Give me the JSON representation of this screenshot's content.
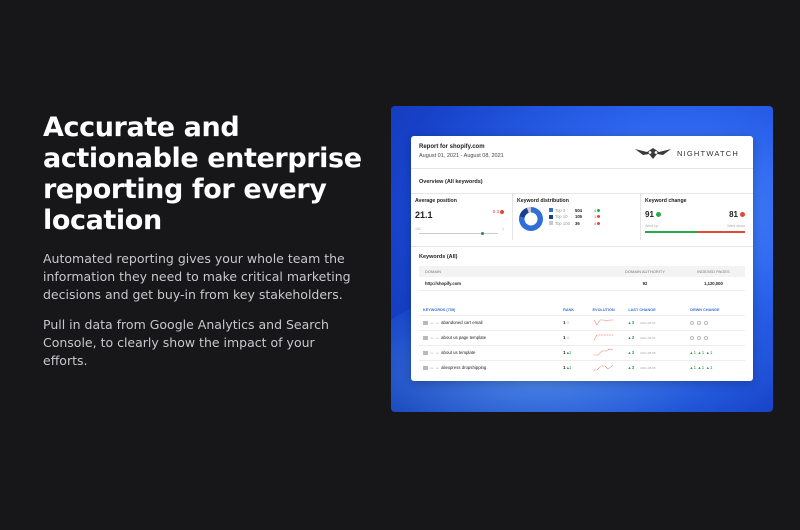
{
  "hero": {
    "title": "Accurate and actionable enterprise reporting for every location",
    "paragraph1": "Automated reporting gives your whole team the information they need to make critical marketing decisions and get buy-in from key stakeholders.",
    "paragraph2": "Pull in data from Google Analytics and Search Console, to clearly show the impact of your efforts."
  },
  "report": {
    "title": "Report for shopify.com",
    "dates": "August 01, 2021 - August 08, 2021",
    "brand": "NIGHTWATCH",
    "overview_heading": "Overview (All keywords)",
    "average_position": {
      "label": "Average position",
      "value": "21.1",
      "change": "0.3",
      "scale_min": "101",
      "scale_max": "1",
      "level": 0.78
    },
    "keyword_distribution": {
      "label": "Keyword distribution",
      "items": [
        {
          "name": "Top 3",
          "value": "504",
          "change": "4",
          "trend": "up",
          "color": "#2f6fd6"
        },
        {
          "name": "Top 10",
          "value": "105",
          "change": "1",
          "trend": "down",
          "color": "#163f8c"
        },
        {
          "name": "Top 100",
          "value": "36",
          "change": "4",
          "trend": "down",
          "color": "#c9c9d6"
        }
      ]
    },
    "keyword_change": {
      "label": "Keyword change",
      "up_value": "91",
      "down_value": "81",
      "up_label": "Went up",
      "down_label": "Went down",
      "up_color": "#2aa84a",
      "down_color": "#e0483a"
    },
    "keywords_heading": "Keywords (All)",
    "domain_table": {
      "headers": [
        "DOMAIN",
        "DOMAIN AUTHORITY",
        "INDEXED PAGES"
      ],
      "rows": [
        [
          "http://shopify.com",
          "92",
          "1,120,000"
        ]
      ]
    },
    "keyword_table": {
      "headers": [
        "KEYWORDS (755)",
        "RANK",
        "EVOLUTION",
        "LAST CHANGE",
        "DRWN CHANGE"
      ],
      "rows": [
        {
          "meta": "us · en",
          "keyword": "abandoned cart email",
          "rank": "1",
          "last_change": "3",
          "date": "2021-08-03",
          "drwn": ""
        },
        {
          "meta": "us · en",
          "keyword": "about us page template",
          "rank": "1",
          "last_change": "3",
          "date": "2021-08-03",
          "drwn": ""
        },
        {
          "meta": "us · en",
          "keyword": "about us template",
          "rank": "1",
          "rank_change": "1",
          "last_change": "3",
          "date": "2021-08-08",
          "drwn": "1"
        },
        {
          "meta": "us · en",
          "keyword": "aliexpress dropshipping",
          "rank": "1",
          "rank_change": "1",
          "last_change": "3",
          "date": "2021-08-08",
          "drwn": "1"
        }
      ]
    }
  }
}
